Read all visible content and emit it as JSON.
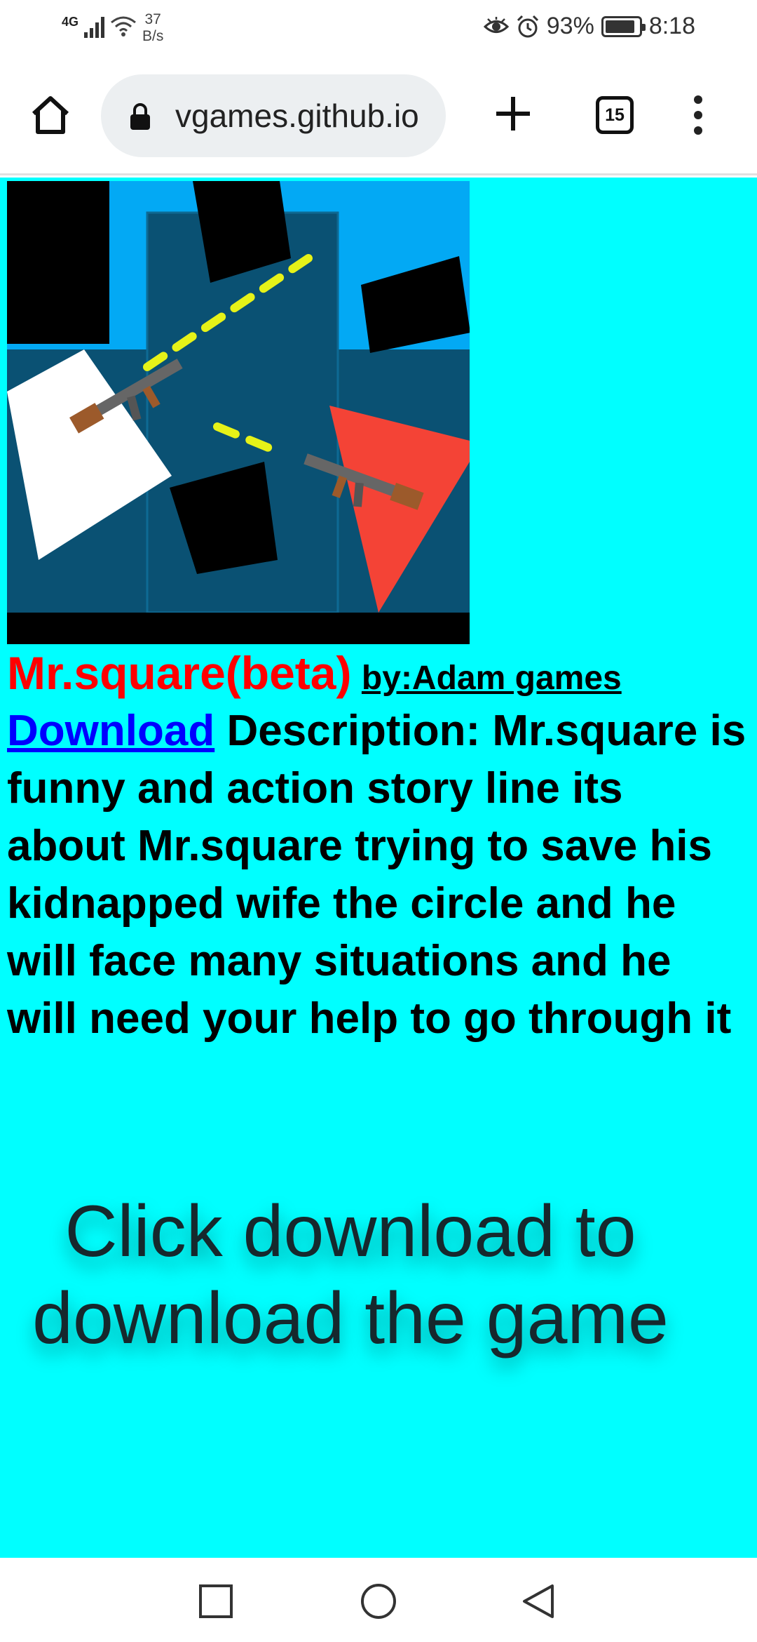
{
  "status_bar": {
    "network": "4G",
    "speed_value": "37",
    "speed_unit": "B/s",
    "battery": "93%",
    "time": "8:18"
  },
  "toolbar": {
    "url": "vgames.github.io",
    "tab_count": "15"
  },
  "page": {
    "title": "Mr.square(beta)",
    "author": "by:Adam games",
    "download_link": "Download",
    "description_label": "Description:",
    "description": "Mr.square is funny and action story line its about Mr.square trying to save his kidnapped wife the circle and he will face many situations and he will need your help to go through it",
    "cta": "Click download to download the game"
  },
  "icons": {
    "home": "home-icon",
    "lock": "lock-icon",
    "new_tab": "plus-icon",
    "menu": "more-vertical-icon",
    "eye_comfort": "eye-icon",
    "alarm": "alarm-icon",
    "recents": "square-icon",
    "home_nav": "circle-icon",
    "back": "triangle-back-icon"
  },
  "colors": {
    "page_background": "#00ffff",
    "title": "#ff0000",
    "link": "#0000ff"
  }
}
